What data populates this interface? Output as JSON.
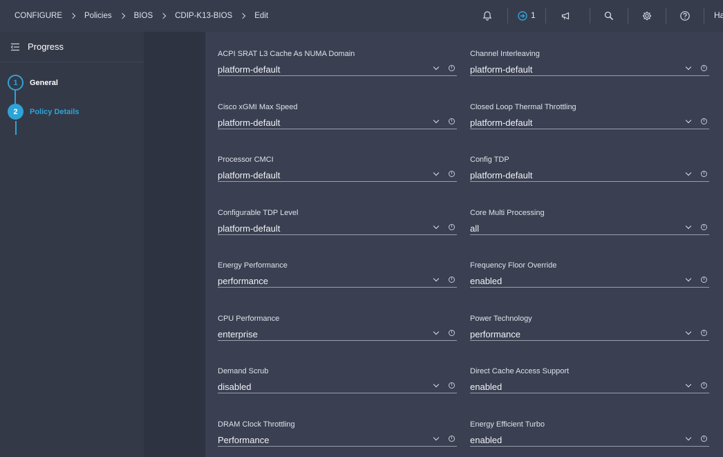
{
  "breadcrumb": {
    "items": [
      "CONFIGURE",
      "Policies",
      "BIOS",
      "CDIP-K13-BIOS",
      "Edit"
    ]
  },
  "topbar": {
    "notifications_icon": "bell-icon",
    "requests_count": "1",
    "user_initial": "Ha"
  },
  "progress": {
    "title": "Progress",
    "steps": [
      {
        "number": "1",
        "label": "General"
      },
      {
        "number": "2",
        "label": "Policy Details"
      }
    ]
  },
  "fields": [
    {
      "label": "ACPI SRAT L3 Cache As NUMA Domain",
      "value": "platform-default"
    },
    {
      "label": "Channel Interleaving",
      "value": "platform-default"
    },
    {
      "label": "Cisco xGMI Max Speed",
      "value": "platform-default"
    },
    {
      "label": "Closed Loop Thermal Throttling",
      "value": "platform-default"
    },
    {
      "label": "Processor CMCI",
      "value": "platform-default"
    },
    {
      "label": "Config TDP",
      "value": "platform-default"
    },
    {
      "label": "Configurable TDP Level",
      "value": "platform-default"
    },
    {
      "label": "Core Multi Processing",
      "value": "all"
    },
    {
      "label": "Energy Performance",
      "value": "performance"
    },
    {
      "label": "Frequency Floor Override",
      "value": "enabled"
    },
    {
      "label": "CPU Performance",
      "value": "enterprise"
    },
    {
      "label": "Power Technology",
      "value": "performance"
    },
    {
      "label": "Demand Scrub",
      "value": "disabled"
    },
    {
      "label": "Direct Cache Access Support",
      "value": "enabled"
    },
    {
      "label": "DRAM Clock Throttling",
      "value": "Performance"
    },
    {
      "label": "Energy Efficient Turbo",
      "value": "enabled"
    }
  ],
  "colors": {
    "accent": "#2ea4d6",
    "background": "#3a3f51",
    "panel": "#343948"
  }
}
